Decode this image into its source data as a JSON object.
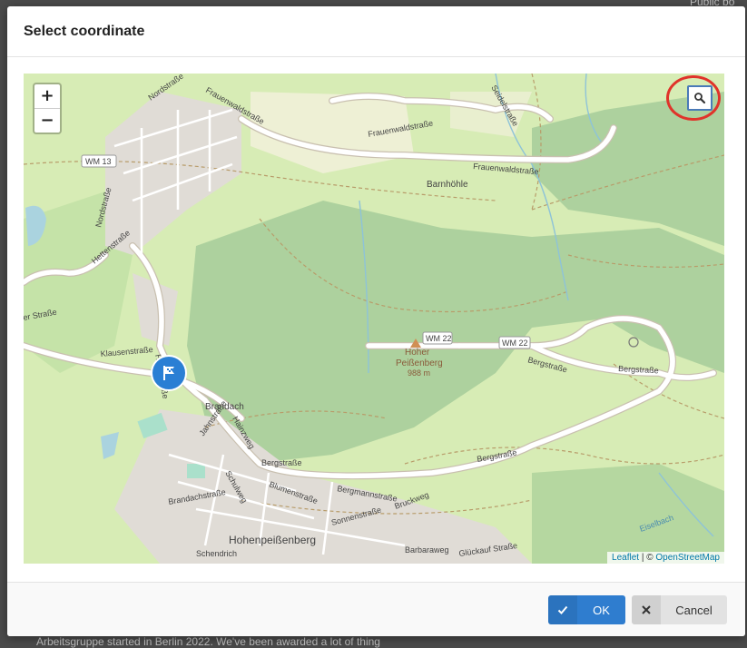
{
  "backdrop": {
    "top_right": "Public bo",
    "bottom_left": "Arbeitsgruppe started in Berlin 2022. We've been awarded a lot of thing"
  },
  "dialog": {
    "title": "Select coordinate"
  },
  "map": {
    "zoom_in": "+",
    "zoom_out": "−",
    "attribution_leaflet": "Leaflet",
    "attribution_sep": " | © ",
    "attribution_osm": "OpenStreetMap",
    "labels": {
      "wm13": "WM 13",
      "wm22a": "WM 22",
      "wm22b": "WM 22",
      "nordstrasse_top": "Nordstraße",
      "frauenwaldstrasse_top": "Frauenwaldstraße",
      "frauenwaldstrasse_mid": "Frauenwaldstraße",
      "frauenwaldstrasse_right": "Frauenwaldstraße",
      "barnhohle": "Barnhöhle",
      "hettenstrasse": "Hettenstraße",
      "nordstrasse_left": "Nordstraße",
      "er_strasse": "er Straße",
      "klausenstrasse": "Klausenstraße",
      "hauptstrasse": "Hauptstraße",
      "hoher": "Hoher",
      "peissenberg": "Peißenberg",
      "elevation": "988 m",
      "bergstrasse_right1": "Bergstraße",
      "bergstrasse_right2": "Bergstraße",
      "brandach": "Brandach",
      "bergstrasse_mid": "Bergstraße",
      "bergstrasse_low": "Bergstraße",
      "hohenpeissenberg": "Hohenpeißenberg",
      "schendrich": "Schendrich",
      "brandachstrasse": "Brandachstraße",
      "blumenstrasse": "Blumenstraße",
      "sonnenstrasse": "Sonnenstraße",
      "barbaraweg": "Barbaraweg",
      "gluckaufstrasse": "Glückauf Straße",
      "bruckweg": "Bruckweg",
      "bergmannstrasse": "Bergmannstraße",
      "eiselbach": "Eiselbach",
      "schulweg": "Schulweg",
      "jahnstrasse": "Jahnstraße",
      "hainzweg": "Hainzweg",
      "seidelstrasse": "Seidelstraße"
    }
  },
  "footer": {
    "ok_label": "OK",
    "cancel_label": "Cancel"
  },
  "colors": {
    "primary": "#2f7dcf",
    "highlight_ring": "#e0332a",
    "forest": "#add19e",
    "meadow": "#d7ecb5"
  },
  "icons": {
    "search": "search-icon",
    "marker": "flag-marker-icon",
    "ok": "check-icon",
    "cancel": "close-icon"
  }
}
